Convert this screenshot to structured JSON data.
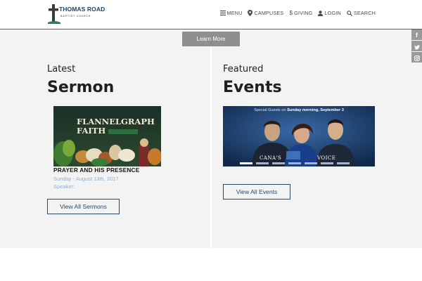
{
  "header": {
    "logo": {
      "line1": "THOMAS ROAD",
      "line2": "BAPTIST CHURCH"
    },
    "nav": [
      {
        "label": "MENU",
        "icon": "menu-icon"
      },
      {
        "label": "CAMPUSES",
        "icon": "location-pin-icon"
      },
      {
        "label": "GIVING",
        "icon": "dollar-icon"
      },
      {
        "label": "LOGIN",
        "icon": "user-icon"
      },
      {
        "label": "SEARCH",
        "icon": "search-icon"
      }
    ]
  },
  "hero": {
    "learn_more": "Learn More"
  },
  "social": [
    "facebook-icon",
    "twitter-icon",
    "instagram-icon"
  ],
  "sermon": {
    "heading_small": "Latest",
    "heading_big": "Sermon",
    "image_text": {
      "line1": "FLANNELGRAPH",
      "line2": "FAITH"
    },
    "title": "PRAYER AND HIS PRESENCE",
    "date": "Sunday - August 13th, 2017",
    "speaker": "Speaker:",
    "button": "View All Sermons"
  },
  "events": {
    "heading_small": "Featured",
    "heading_big": "Events",
    "image_text": {
      "guests_prefix": "Special Guests on ",
      "guests_day": "Sunday morning, September 3",
      "band_left": "CANA'S",
      "band_right": "VOICE"
    },
    "button": "View All Events"
  },
  "colors": {
    "accent": "#2a4a66",
    "meta": "#8fb0c8",
    "panel": "#f3f3f3",
    "button_gray": "#8f8f8f"
  }
}
